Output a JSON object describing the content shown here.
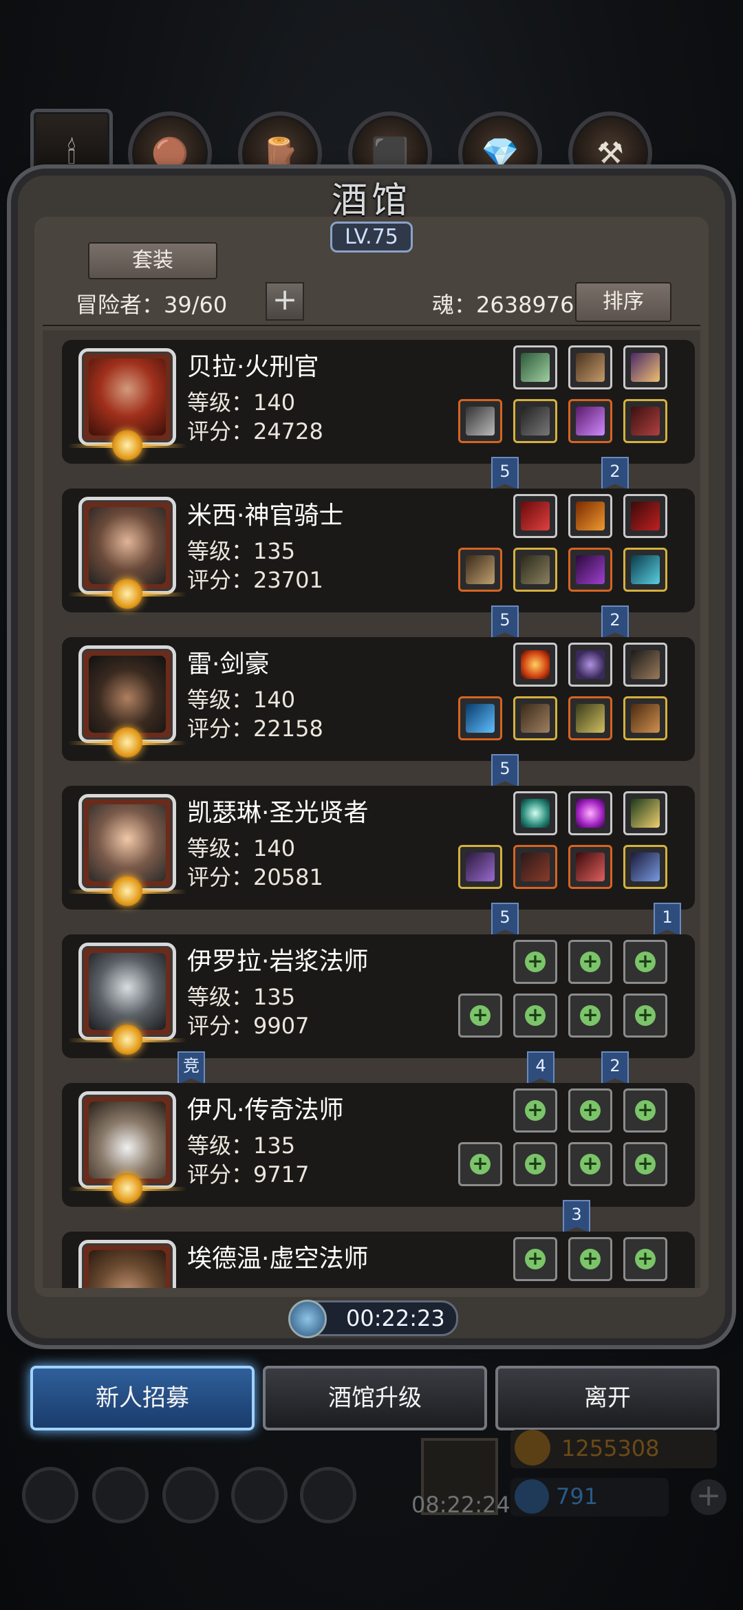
{
  "top_tabs": [
    {
      "icon": "tavern-icon"
    },
    {
      "icon": "leather-icon"
    },
    {
      "icon": "wood-icon"
    },
    {
      "icon": "ingot-icon"
    },
    {
      "icon": "crystal-icon"
    },
    {
      "icon": "anvil-icon"
    }
  ],
  "header": {
    "title": "酒馆",
    "level": "LV.75",
    "set_button": "套装",
    "adventurers_label": "冒险者：39/60",
    "soul_label": "魂：2638976",
    "sort_button": "排序"
  },
  "heroes": [
    {
      "name": "贝拉·火刑官",
      "level": "等级：140",
      "score": "评分：24728"
    },
    {
      "name": "米西·神官骑士",
      "level": "等级：135",
      "score": "评分：23701"
    },
    {
      "name": "雷·剑豪",
      "level": "等级：140",
      "score": "评分：22158"
    },
    {
      "name": "凯瑟琳·圣光贤者",
      "level": "等级：140",
      "score": "评分：20581"
    },
    {
      "name": "伊罗拉·岩浆法师",
      "level": "等级：135",
      "score": "评分：9907"
    },
    {
      "name": "伊凡·传奇法师",
      "level": "等级：135",
      "score": "评分：9717"
    },
    {
      "name": "埃德温·虚空法师",
      "level": "",
      "score": ""
    }
  ],
  "flags": [
    "5",
    "2",
    "5",
    "2",
    "5",
    "5",
    "1",
    "竞",
    "4",
    "2",
    "3"
  ],
  "footer": {
    "timer": "00:22:23",
    "recruit_button": "新人招募",
    "upgrade_button": "酒馆升级",
    "leave_button": "离开",
    "gold": "1255308",
    "gems": "791",
    "clock": "08:22:24"
  },
  "colors": {
    "accent_blue": "#2f5f9a",
    "gold_glow": "#ffb43a",
    "panel": "#4a443e"
  }
}
